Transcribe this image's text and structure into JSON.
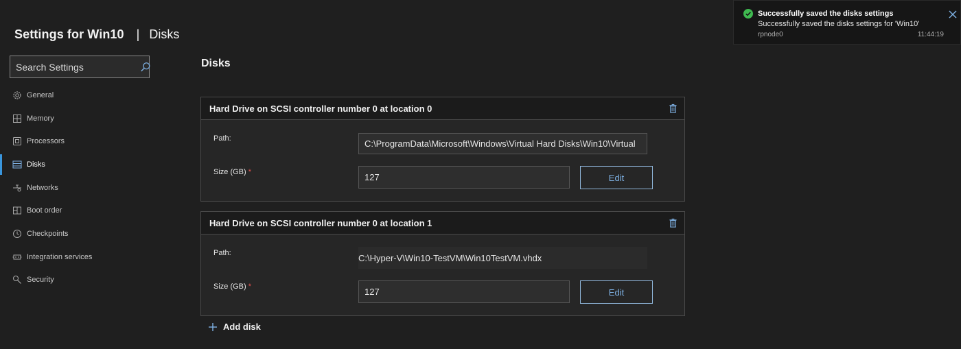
{
  "header": {
    "title": "Settings for Win10",
    "separator": "|",
    "subtitle": "Disks"
  },
  "search": {
    "placeholder": "Search Settings",
    "value": ""
  },
  "nav": {
    "items": [
      {
        "label": "General",
        "icon": "gear-icon"
      },
      {
        "label": "Memory",
        "icon": "memory-icon"
      },
      {
        "label": "Processors",
        "icon": "processor-icon"
      },
      {
        "label": "Disks",
        "icon": "disk-icon",
        "active": true
      },
      {
        "label": "Networks",
        "icon": "network-icon"
      },
      {
        "label": "Boot order",
        "icon": "boot-order-icon"
      },
      {
        "label": "Checkpoints",
        "icon": "checkpoint-icon"
      },
      {
        "label": "Integration services",
        "icon": "integration-icon"
      },
      {
        "label": "Security",
        "icon": "security-icon"
      }
    ]
  },
  "main": {
    "title": "Disks",
    "disks": [
      {
        "title": "Hard Drive on SCSI controller number 0 at location 0",
        "path_label": "Path:",
        "path_value": "C:\\ProgramData\\Microsoft\\Windows\\Virtual Hard Disks\\Win10\\Virtual",
        "size_label": "Size (GB)",
        "required_mark": "*",
        "size_value": "127",
        "edit_label": "Edit"
      },
      {
        "title": "Hard Drive on SCSI controller number 0 at location 1",
        "path_label": "Path:",
        "path_value": "C:\\Hyper-V\\Win10-TestVM\\Win10TestVM.vhdx",
        "size_label": "Size (GB)",
        "required_mark": "*",
        "size_value": "127",
        "edit_label": "Edit"
      }
    ],
    "add_disk_label": "Add disk"
  },
  "toast": {
    "title": "Successfully saved the disks settings",
    "message": "Successfully saved the disks settings for 'Win10'",
    "node": "rpnode0",
    "time": "11:44:19"
  },
  "colors": {
    "accent": "#3a96dd",
    "success": "#3fb950",
    "required": "#e8524f",
    "link": "#7fb2e5"
  }
}
